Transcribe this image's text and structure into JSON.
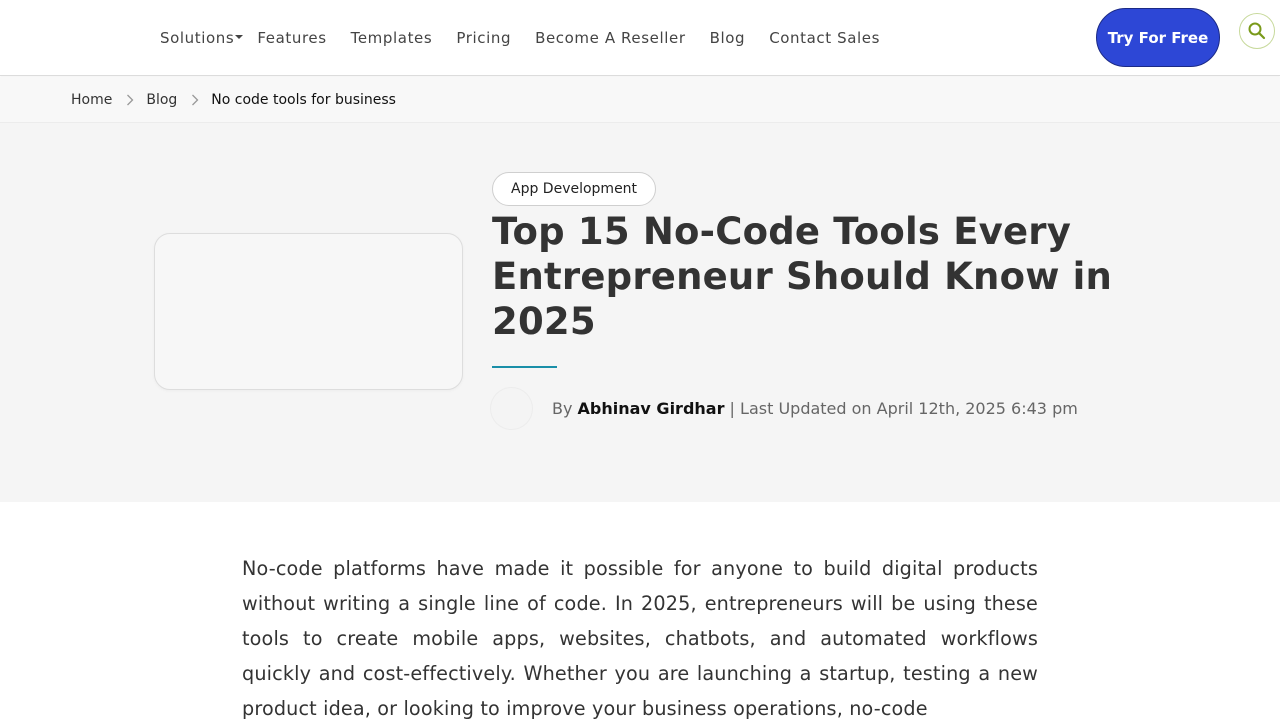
{
  "header": {
    "nav": [
      {
        "label": "Solutions",
        "has_dropdown": true
      },
      {
        "label": "Features"
      },
      {
        "label": "Templates"
      },
      {
        "label": "Pricing"
      },
      {
        "label": "Become A Reseller"
      },
      {
        "label": "Blog"
      },
      {
        "label": "Contact Sales"
      }
    ],
    "cta_label": "Try For Free",
    "search_icon": "search-icon",
    "accent_color": "#2d47d6"
  },
  "breadcrumb": {
    "items": [
      "Home",
      "Blog"
    ],
    "current": "No code tools for business",
    "separator_icon": "chevron-right-icon"
  },
  "hero": {
    "category": "App Development",
    "title": "Top 15 No-Code Tools Every Entrepreneur Should Know in 2025",
    "byline_prefix": "By ",
    "author": "Abhinav Girdhar",
    "byline_suffix": " | Last Updated on April 12th, 2025 6:43 pm",
    "rule_color": "#1a8fa8"
  },
  "article": {
    "intro": "No-code platforms have made it possible for anyone to build digital products without writing a single line of code. In 2025, entrepreneurs will be using these tools to create mobile apps, websites, chatbots, and automated workflows quickly and cost-effectively. Whether you are launching a startup, testing a new product idea, or looking to improve your business operations, no-code"
  }
}
